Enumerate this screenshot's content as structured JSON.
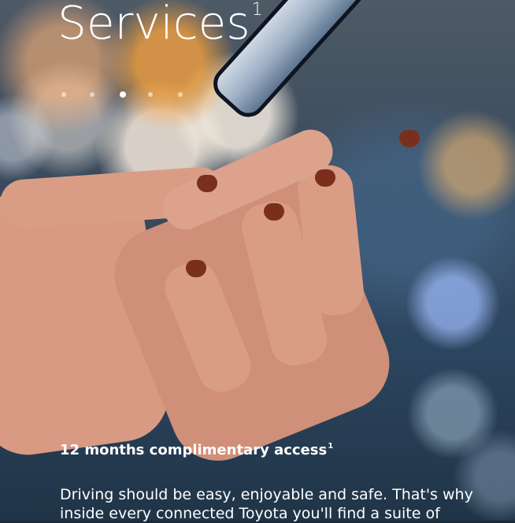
{
  "hero": {
    "title": "Services",
    "title_sup": "1",
    "carousel": {
      "dot_count": 5,
      "active_index": 1
    }
  },
  "content": {
    "subhead": "12 months complimentary access",
    "subhead_sup": "1",
    "body_line1": "Driving should be easy, enjoyable and safe. That's why",
    "body_line2": "inside every connected Toyota you'll find a suite of"
  }
}
